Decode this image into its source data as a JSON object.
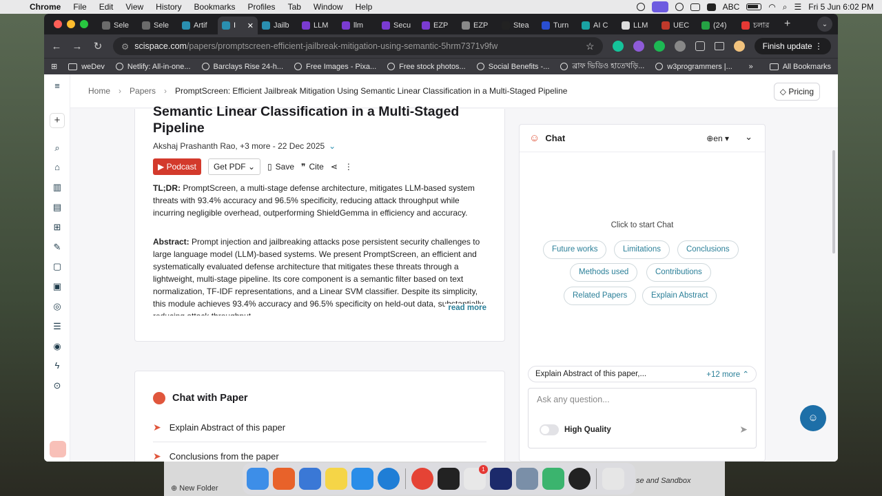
{
  "menubar": {
    "app": "Chrome",
    "items": [
      "File",
      "Edit",
      "View",
      "History",
      "Bookmarks",
      "Profiles",
      "Tab",
      "Window",
      "Help"
    ],
    "input_source": "ABC",
    "datetime": "Fri 5 Jun  6:02 PM"
  },
  "tabs": [
    {
      "label": "Sele",
      "color": "#6b6b6b"
    },
    {
      "label": "Sele",
      "color": "#6b6b6b"
    },
    {
      "label": "Artif",
      "color": "#2a8fb0"
    },
    {
      "label": "I",
      "color": "#2a8fb0",
      "active": true
    },
    {
      "label": "Jailb",
      "color": "#2a8fb0"
    },
    {
      "label": "LLM",
      "color": "#7a3bd1"
    },
    {
      "label": "llm",
      "color": "#7a3bd1"
    },
    {
      "label": "Secu",
      "color": "#7a3bd1"
    },
    {
      "label": "EZP",
      "color": "#7a3bd1"
    },
    {
      "label": "EZP",
      "color": "#888888"
    },
    {
      "label": "Stea",
      "color": "#222222"
    },
    {
      "label": "Turn",
      "color": "#2a4fd1"
    },
    {
      "label": "AI C",
      "color": "#1aa3a3"
    },
    {
      "label": "LLM",
      "color": "#dddddd"
    },
    {
      "label": "UEC",
      "color": "#c0392b"
    },
    {
      "label": "(24)",
      "color": "#25a244"
    },
    {
      "label": "চলার",
      "color": "#e53935"
    }
  ],
  "omnibox": {
    "host": "scispace.com",
    "path": "/papers/promptscreen-efficient-jailbreak-mitigation-using-semantic-5hrm7371v9fw"
  },
  "finish_update": "Finish update",
  "bookmarks": [
    {
      "label": "weDev",
      "type": "folder"
    },
    {
      "label": "Netlify: All-in-one...",
      "type": "site"
    },
    {
      "label": "Barclays Rise 24-h...",
      "type": "site"
    },
    {
      "label": "Free Images - Pixa...",
      "type": "site"
    },
    {
      "label": "Free stock photos...",
      "type": "site"
    },
    {
      "label": "Social Benefits -...",
      "type": "site"
    },
    {
      "label": "ব্রাফ ভিডিও হাতেখড়ি...",
      "type": "site"
    },
    {
      "label": "w3programmers |...",
      "type": "site"
    }
  ],
  "all_bookmarks": "All Bookmarks",
  "breadcrumb": {
    "home": "Home",
    "papers": "Papers",
    "current": "PromptScreen: Efficient Jailbreak Mitigation Using Semantic Linear Classification in a Multi-Staged Pipeline"
  },
  "pricing": "Pricing",
  "paper": {
    "title": "Semantic Linear Classification in a Multi-Staged Pipeline",
    "authors": "Akshaj Prashanth Rao,  +3 more",
    "date": "22 Dec 2025",
    "actions": {
      "podcast": "Podcast",
      "get_pdf": "Get PDF",
      "save": "Save",
      "cite": "Cite"
    },
    "tldr_label": "TL;DR:",
    "tldr": "PromptScreen, a multi-stage defense architecture, mitigates LLM-based system threats with 93.4% accuracy and 96.5% specificity, reducing attack throughput while incurring negligible overhead, outperforming ShieldGemma in efficiency and accuracy.",
    "abstract_label": "Abstract:",
    "abstract": "Prompt injection and jailbreaking attacks pose persistent security challenges to large language model (LLM)-based systems. We present PromptScreen, an efficient and systematically evaluated defense architecture that mitigates these threats through a lightweight, multi-stage pipeline. Its core component is a semantic filter based on text normalization, TF-IDF representations, and a Linear SVM classifier. Despite its simplicity, this module achieves 93.4% accuracy and 96.5% specificity on held-out data, substantially reducing attack throughput",
    "read_more": "read more"
  },
  "chat_with_paper": {
    "heading": "Chat with Paper",
    "items": [
      "Explain Abstract of this paper",
      "Conclusions from the paper"
    ]
  },
  "chat_panel": {
    "title": "Chat",
    "language": "en",
    "start": "Click to start Chat",
    "chips": [
      "Future works",
      "Limitations",
      "Conclusions",
      "Methods used",
      "Contributions",
      "Related Papers",
      "Explain Abstract"
    ],
    "suggestion": "Explain Abstract of this paper,...",
    "suggestion_more": "+12 more",
    "input_placeholder": "Ask any question...",
    "high_quality": "High Quality"
  },
  "finder": {
    "new_folder": "New Folder",
    "sandbox": "se and Sandbox"
  },
  "dock": {
    "badge": "1"
  },
  "colors": {
    "accent": "#2a7f98",
    "podcast": "#d33a2c",
    "brand_orange": "#e0563c"
  }
}
